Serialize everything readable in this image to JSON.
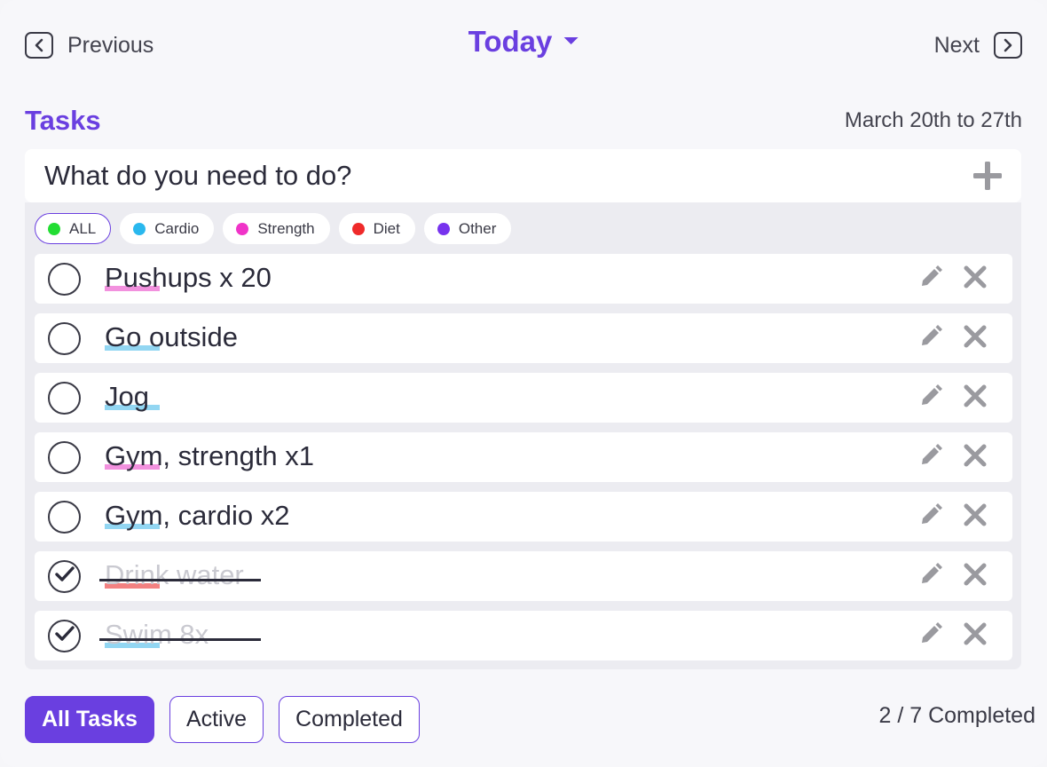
{
  "nav": {
    "previous_label": "Previous",
    "next_label": "Next",
    "period_label": "Today"
  },
  "tasks_header": {
    "title": "Tasks",
    "date_range": "March 20th to 27th"
  },
  "new_task": {
    "placeholder": "What do you need to do?"
  },
  "filters": [
    {
      "label": "ALL",
      "color": "#22dd33",
      "active": true
    },
    {
      "label": "Cardio",
      "color": "#2ab8ee",
      "active": false
    },
    {
      "label": "Strength",
      "color": "#f033c8",
      "active": false
    },
    {
      "label": "Diet",
      "color": "#ef2a2a",
      "active": false
    },
    {
      "label": "Other",
      "color": "#7733ee",
      "active": false
    }
  ],
  "tasks": [
    {
      "text": "Pushups x 20",
      "category": "Strength",
      "mark_color": "#f07ed8",
      "completed": false
    },
    {
      "text": "Go outside",
      "category": "Cardio",
      "mark_color": "#7fcff0",
      "completed": false
    },
    {
      "text": "Jog",
      "category": "Cardio",
      "mark_color": "#7fcff0",
      "completed": false
    },
    {
      "text": "Gym, strength x1",
      "category": "Strength",
      "mark_color": "#f07ed8",
      "completed": false
    },
    {
      "text": "Gym, cardio x2",
      "category": "Cardio",
      "mark_color": "#7fcff0",
      "completed": false
    },
    {
      "text": "Drink water",
      "category": "Diet",
      "mark_color": "#f06b6b",
      "completed": true
    },
    {
      "text": "Swim 8x",
      "category": "Cardio",
      "mark_color": "#7fcff0",
      "completed": true
    }
  ],
  "tabs": [
    {
      "label": "All Tasks",
      "active": true
    },
    {
      "label": "Active",
      "active": false
    },
    {
      "label": "Completed",
      "active": false
    }
  ],
  "summary": {
    "completed_text": "2 / 7 Completed"
  },
  "colors": {
    "accent": "#6a3fe0"
  }
}
